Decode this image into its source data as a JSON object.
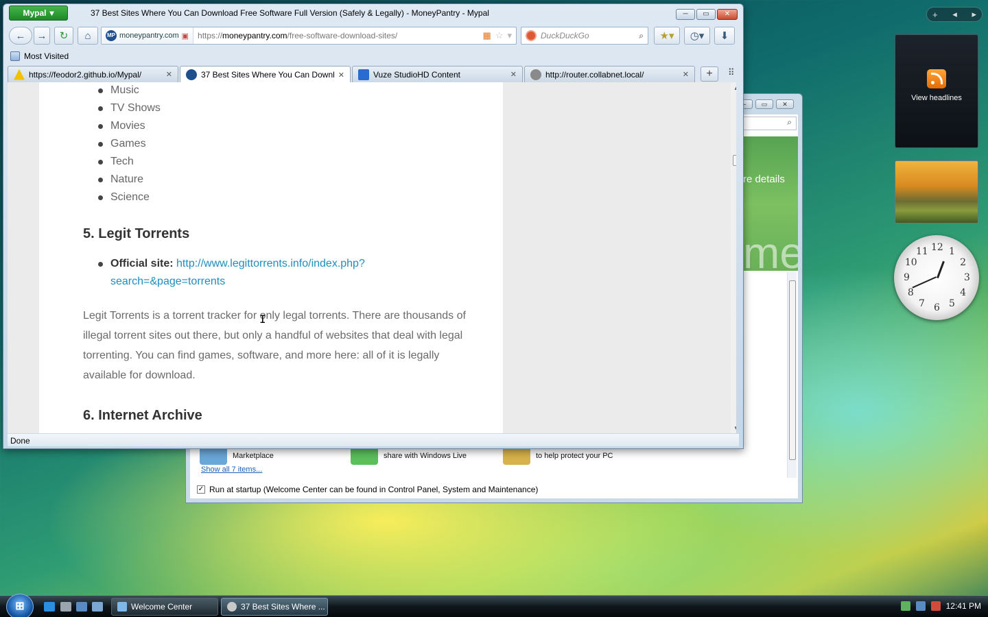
{
  "sidebar": {
    "add": "+",
    "feed_label": "View headlines"
  },
  "clock": {
    "numbers": [
      "12",
      "1",
      "2",
      "3",
      "4",
      "5",
      "6",
      "7",
      "8",
      "9",
      "10",
      "11"
    ],
    "hour": 12,
    "minute": 41
  },
  "welcome_center": {
    "details_text": "re details",
    "big_text": "me",
    "items": [
      {
        "label": "Marketplace",
        "color": "#6aa6d8"
      },
      {
        "label": "share with Windows Live",
        "color": "#5bbf5b"
      },
      {
        "label": "to help protect your PC",
        "color": "#d8b24a"
      }
    ],
    "show_all": "Show all 7 items...",
    "startup_label": "Run at startup (Welcome Center can be found in Control Panel, System and Maintenance)",
    "startup_checked": "✓"
  },
  "browser": {
    "app_menu": "Mypal",
    "window_title": "37 Best Sites Where You Can Download Free Software Full Version (Safely & Legally) - MoneyPantry - Mypal",
    "identity": "moneypantry.com",
    "identity_icon": "MP",
    "url_prefix": "https://",
    "url_domain": "moneypantry.com",
    "url_path": "/free-software-download-sites/",
    "search_placeholder": "DuckDuckGo",
    "bookmarks_label": "Most Visited",
    "tabs": [
      {
        "label": "https://feodor2.github.io/Mypal/",
        "icon_color": "#f2c200"
      },
      {
        "label": "37 Best Sites Where You Can Downlo...",
        "icon_color": "#1f4f8f"
      },
      {
        "label": "Vuze StudioHD Content",
        "icon_color": "#2a6bd1"
      },
      {
        "label": "http://router.collabnet.local/",
        "icon_color": "#8a8a8a"
      }
    ],
    "status": "Done"
  },
  "article": {
    "categories": [
      "Music",
      "TV Shows",
      "Movies",
      "Games",
      "Tech",
      "Nature",
      "Science"
    ],
    "heading5": "5. Legit Torrents",
    "official_label": "Official site:",
    "official_link": "http://www.legittorrents.info/index.php?search=&page=torrents",
    "paragraph": "Legit Torrents is a torrent tracker for only legal torrents. There are thousands of illegal torrent sites out there, but only a handful of websites that deal with legal torrenting. You can find games, software, and more here: all of it is legally available for download.",
    "heading6": "6. Internet Archive"
  },
  "taskbar": {
    "start": "⊞",
    "buttons": [
      {
        "label": "Welcome Center",
        "icon_color": "#7fb8e6"
      },
      {
        "label": "37 Best Sites Where ...",
        "icon_color": "#c9c9c9"
      }
    ],
    "time": "12:41 PM"
  }
}
